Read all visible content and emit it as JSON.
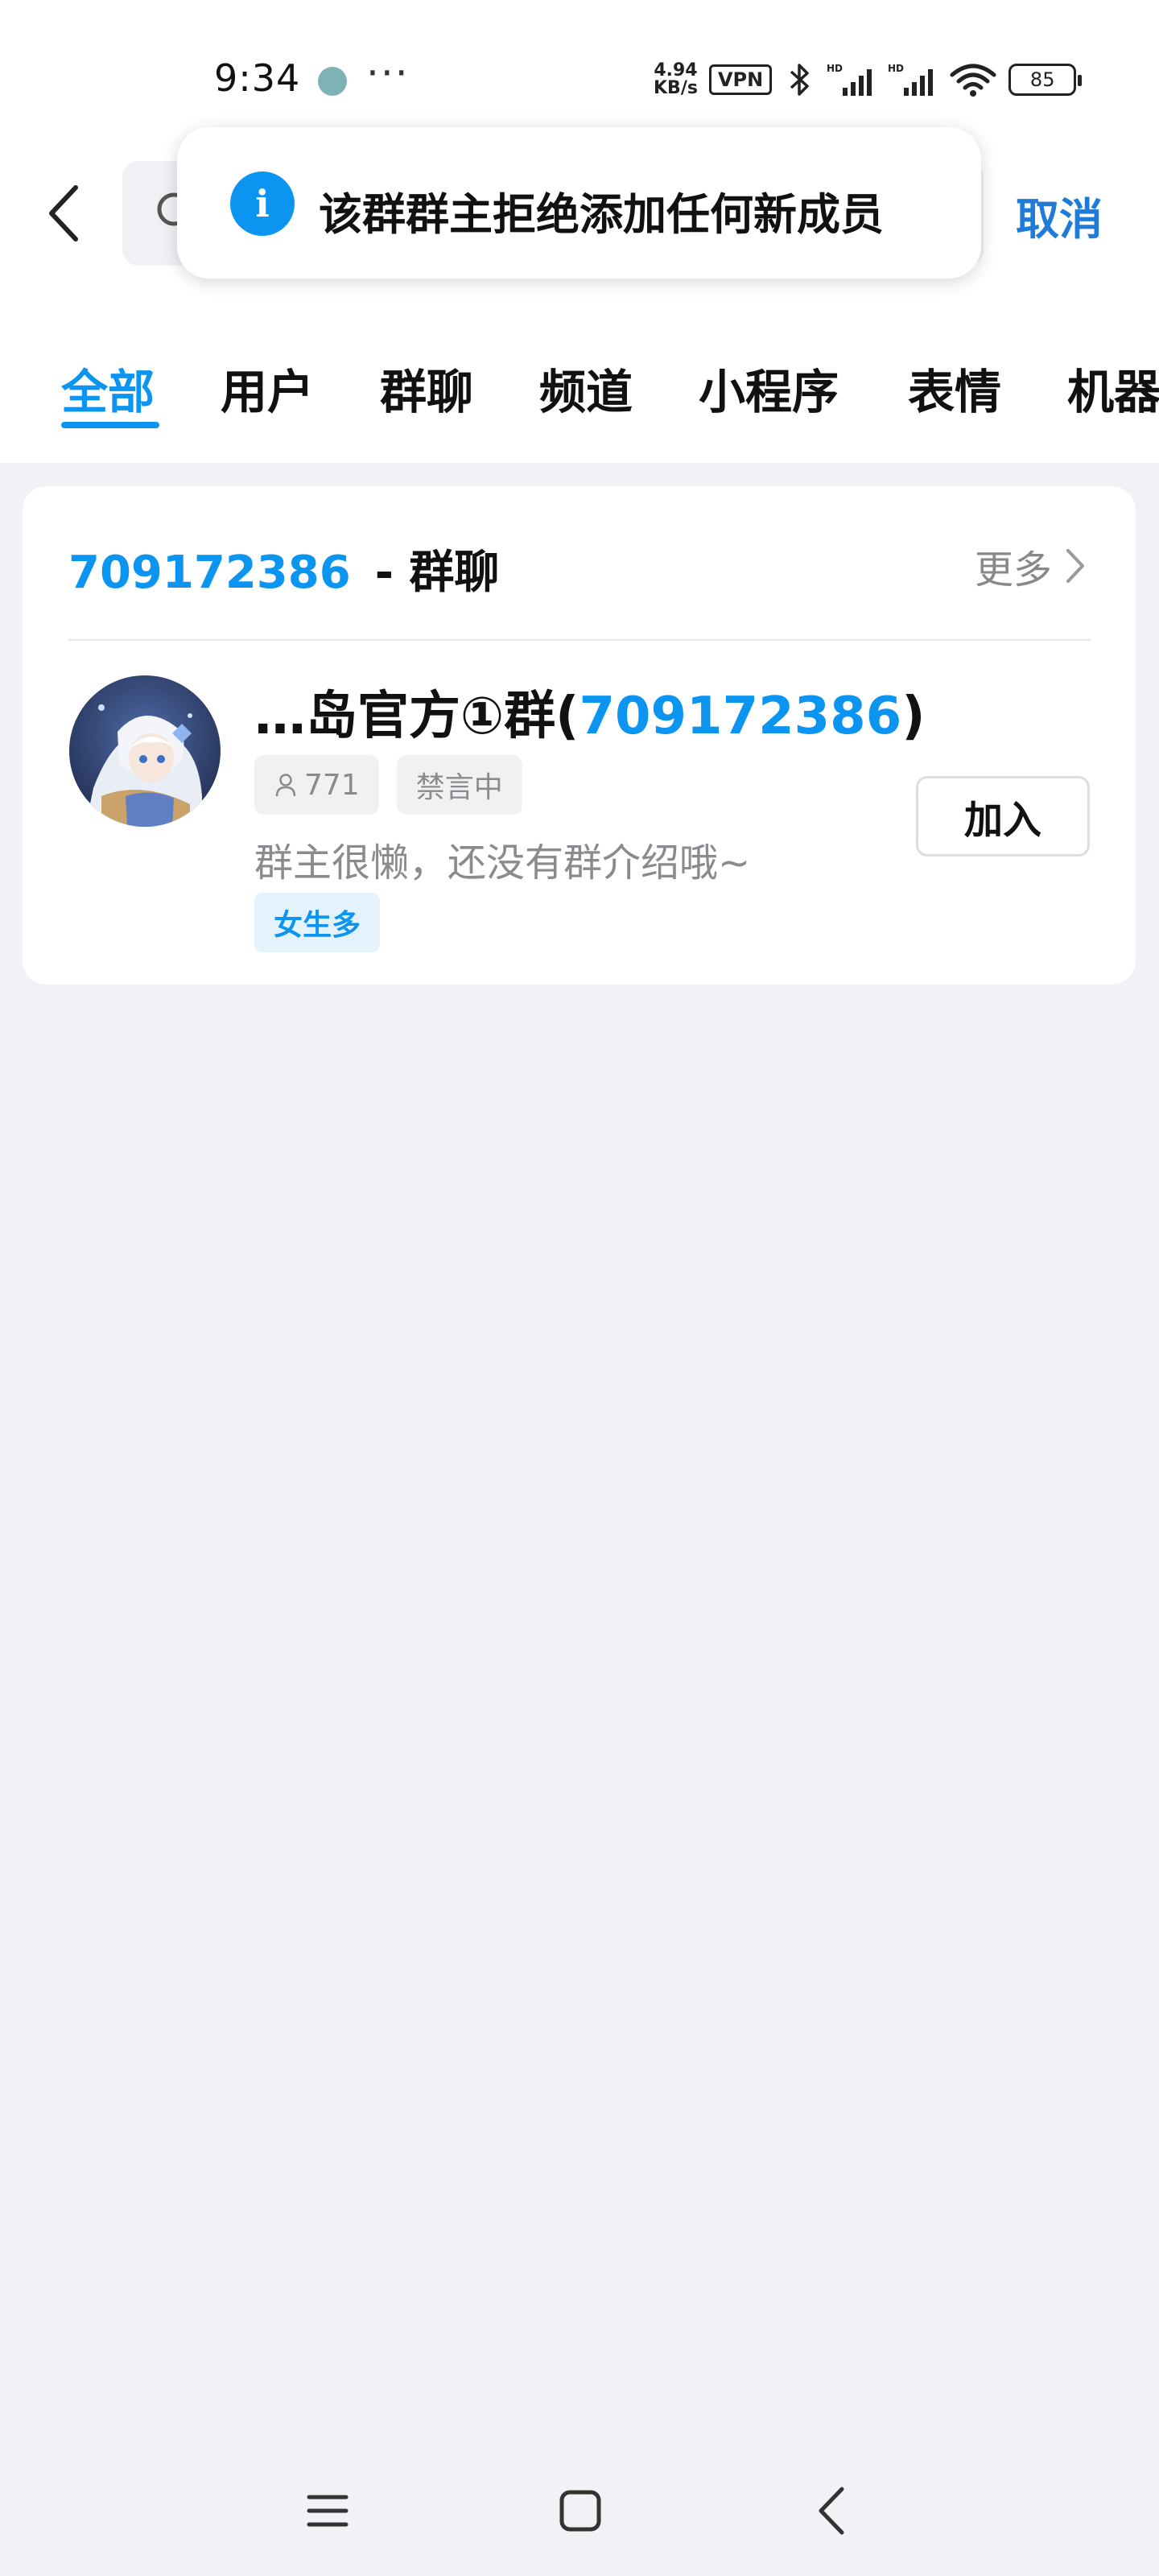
{
  "status_bar": {
    "time": "9:34",
    "net_speed_value": "4.94",
    "net_speed_unit": "KB/s",
    "vpn": "VPN",
    "battery": "85"
  },
  "header": {
    "cancel_label": "取消"
  },
  "toast": {
    "message": "该群群主拒绝添加任何新成员"
  },
  "tabs": [
    {
      "label": "全部",
      "active": true
    },
    {
      "label": "用户",
      "active": false
    },
    {
      "label": "群聊",
      "active": false
    },
    {
      "label": "频道",
      "active": false
    },
    {
      "label": "小程序",
      "active": false
    },
    {
      "label": "表情",
      "active": false
    },
    {
      "label": "机器",
      "active": false
    }
  ],
  "result": {
    "query_number": "709172386",
    "section_suffix": "- 群聊",
    "more_label": "更多",
    "group": {
      "name_prefix": "…岛官方①群(",
      "name_number": "709172386",
      "name_suffix": ")",
      "member_count": "771",
      "mute_status": "禁言中",
      "intro": "群主很懒，还没有群介绍哦~",
      "label": "女生多",
      "join_label": "加入"
    }
  },
  "colors": {
    "accent": "#0b95f0",
    "cancel": "#1f7ad8",
    "page_bg": "#f1f1f6"
  }
}
